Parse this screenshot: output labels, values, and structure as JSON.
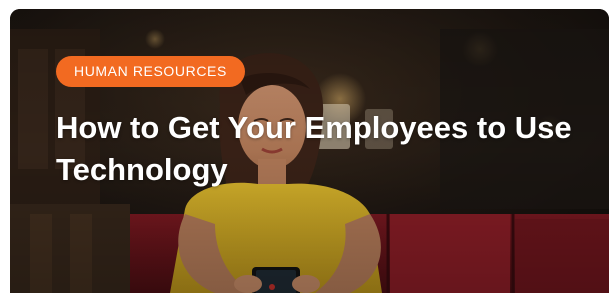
{
  "article_card": {
    "category": "HUMAN RESOURCES",
    "title": "How to Get Your Employees to Use Technology",
    "colors": {
      "badge": "#f26a21",
      "title_text": "#ffffff"
    }
  }
}
